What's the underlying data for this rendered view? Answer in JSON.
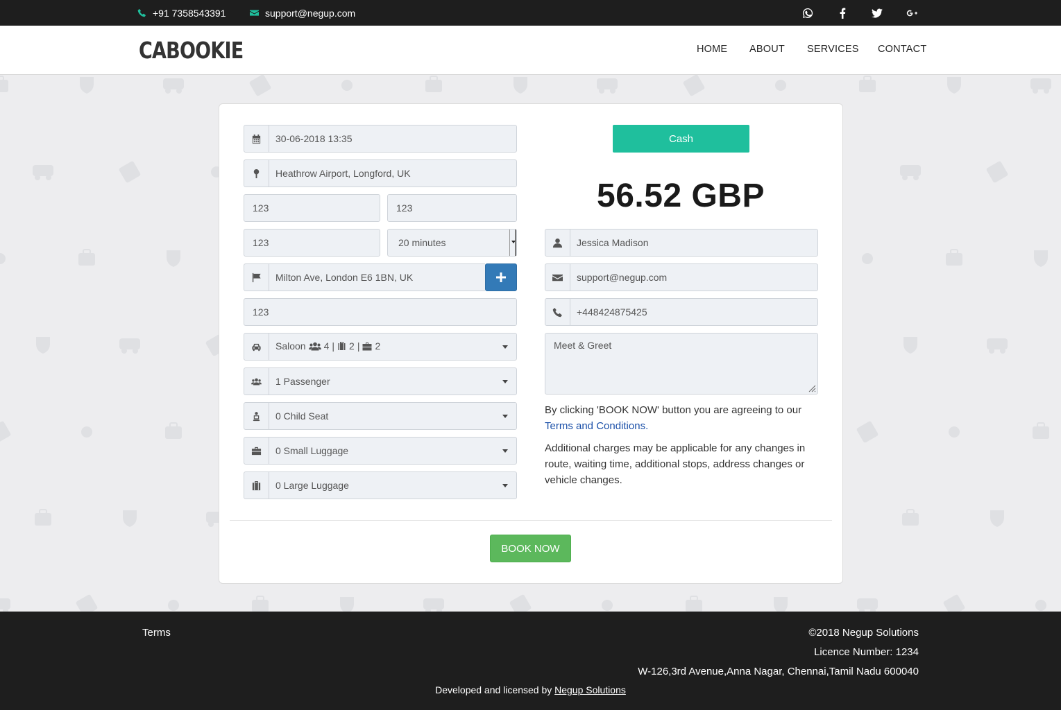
{
  "topbar": {
    "phone": "+91 7358543391",
    "email": "support@negup.com",
    "social": [
      "whatsapp-icon",
      "facebook-icon",
      "twitter-icon",
      "google-plus-icon"
    ]
  },
  "navbar": {
    "logo": "CABOOKIE",
    "links": [
      "HOME",
      "ABOUT",
      "SERVICES",
      "CONTACT"
    ]
  },
  "form": {
    "datetime": "30-06-2018 13:35",
    "pickup": "Heathrow Airport, Longford, UK",
    "field_a": "123",
    "field_b": "123",
    "field_c": "123",
    "wait_time": "20 minutes",
    "dropoff": "Milton Ave, London E6 1BN, UK",
    "field_d": "123",
    "vehicle": {
      "name": "Saloon",
      "passengers": "4",
      "small_luggage": "2",
      "large_luggage": "2",
      "sep": "|"
    },
    "passengers": "1 Passenger",
    "child_seat": "0 Child Seat",
    "small_luggage": "0 Small Luggage",
    "large_luggage": "0 Large Luggage"
  },
  "payment": {
    "method": "Cash",
    "price": "56.52 GBP",
    "name": "Jessica Madison",
    "email": "support@negup.com",
    "phone": "+448424875425",
    "notes": "Meet & Greet",
    "agree_text": "By clicking 'BOOK NOW' button you are agreeing to our",
    "terms_link": "Terms and Conditions.",
    "charges_text": "Additional charges may be applicable for any changes in route, waiting time, additional stops, address changes or vehicle changes.",
    "book_label": "BOOK NOW"
  },
  "footer": {
    "terms": "Terms",
    "copyright": "©2018 Negup Solutions",
    "licence": "Licence Number: 1234",
    "address": "W-126,3rd Avenue,Anna Nagar, Chennai,Tamil Nadu 600040",
    "dev_text": "Developed and licensed by",
    "dev_link": "Negup Solutions"
  },
  "colors": {
    "accent": "#1fbf9d",
    "primary": "#337ab7",
    "success": "#5cb85c",
    "dark": "#1e1e1e"
  }
}
